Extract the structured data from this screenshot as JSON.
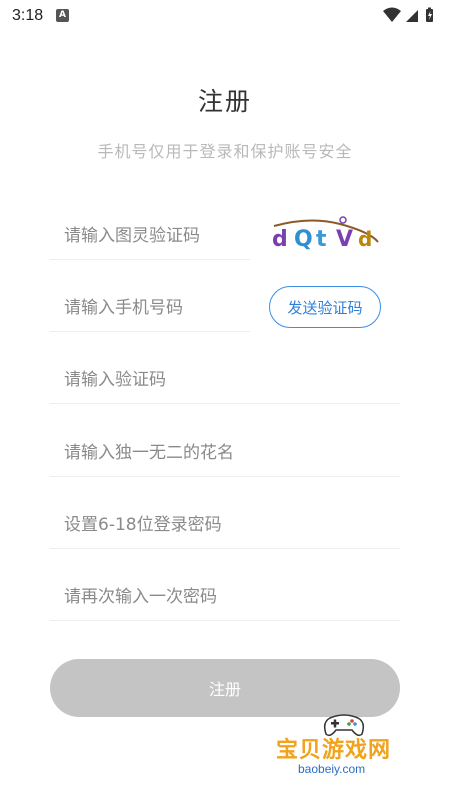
{
  "status_bar": {
    "time": "3:18",
    "app_icon_letter": "A",
    "icons": [
      "wifi-icon",
      "signal-icon",
      "battery-icon"
    ]
  },
  "page": {
    "title": "注册",
    "subtitle": "手机号仅用于登录和保护账号安全"
  },
  "form": {
    "captcha_placeholder": "请输入图灵验证码",
    "captcha_text": "dQtVd",
    "phone_placeholder": "请输入手机号码",
    "send_code_label": "发送验证码",
    "sms_code_placeholder": "请输入验证码",
    "nickname_placeholder": "请输入独一无二的花名",
    "password_placeholder": "设置6-18位登录密码",
    "confirm_password_placeholder": "请再次输入一次密码",
    "submit_label": "注册"
  },
  "watermark": {
    "text": "宝贝游戏网",
    "domain": "baobeiy.com"
  },
  "colors": {
    "accent": "#3a8ee6",
    "disabled_button": "#c4c4c4",
    "watermark_orange": "#f2a21b"
  }
}
